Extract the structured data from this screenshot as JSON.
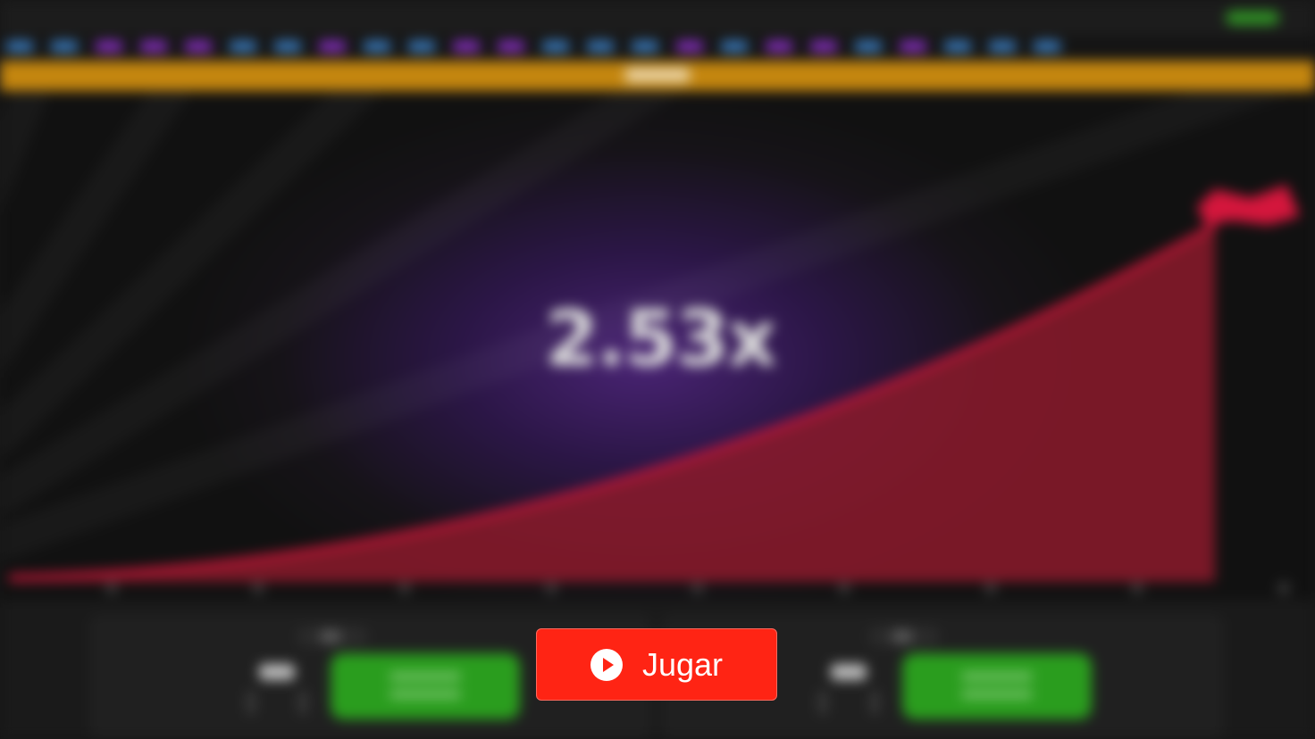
{
  "game": {
    "multiplier": "2.53x"
  },
  "play_button": {
    "label": "Jugar",
    "icon": "play-circle-icon",
    "color": "#ff2414"
  },
  "colors": {
    "accent_gold": "#c4860f",
    "curve_red": "#d4163c",
    "bet_green": "#2a9d1e",
    "glow_purple": "#4a2475"
  }
}
